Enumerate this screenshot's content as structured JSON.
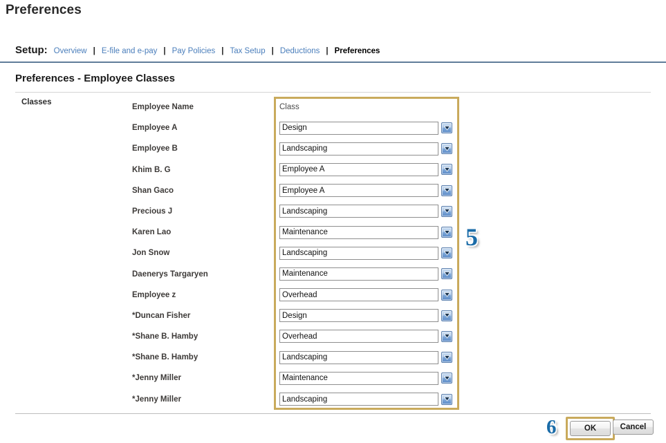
{
  "page": {
    "title": "Preferences"
  },
  "setup_nav": {
    "label": "Setup:",
    "separator": "|",
    "items": [
      {
        "label": "Overview",
        "current": false
      },
      {
        "label": "E-file and e-pay",
        "current": false
      },
      {
        "label": "Pay Policies",
        "current": false
      },
      {
        "label": "Tax Setup",
        "current": false
      },
      {
        "label": "Deductions",
        "current": false
      },
      {
        "label": "Preferences",
        "current": true
      }
    ]
  },
  "section": {
    "title": "Preferences - Employee Classes",
    "row_label": "Classes"
  },
  "table": {
    "headers": {
      "employee_name": "Employee Name",
      "class": "Class"
    },
    "rows": [
      {
        "employee_name": "Employee A",
        "class": "Design"
      },
      {
        "employee_name": "Employee B",
        "class": "Landscaping"
      },
      {
        "employee_name": "Khim B. G",
        "class": "Employee A"
      },
      {
        "employee_name": "Shan Gaco",
        "class": "Employee A"
      },
      {
        "employee_name": "Precious J",
        "class": "Landscaping"
      },
      {
        "employee_name": "Karen Lao",
        "class": "Maintenance"
      },
      {
        "employee_name": "Jon Snow",
        "class": "Landscaping"
      },
      {
        "employee_name": "Daenerys Targaryen",
        "class": "Maintenance"
      },
      {
        "employee_name": "Employee z",
        "class": "Overhead"
      },
      {
        "employee_name": "*Duncan Fisher",
        "class": "Design"
      },
      {
        "employee_name": "*Shane B. Hamby",
        "class": "Overhead"
      },
      {
        "employee_name": "*Shane B. Hamby",
        "class": "Landscaping"
      },
      {
        "employee_name": "*Jenny Miller",
        "class": "Maintenance"
      },
      {
        "employee_name": "*Jenny Miller",
        "class": "Landscaping"
      }
    ]
  },
  "callouts": {
    "class_column": "5",
    "ok_button": "6"
  },
  "footer": {
    "ok_label": "OK",
    "cancel_label": "Cancel"
  },
  "colors": {
    "highlight_gold": "#c9aa5c",
    "link_blue": "#4a7ebb",
    "callout_blue": "#1b6ca8",
    "nav_rule": "#5f7c99"
  }
}
